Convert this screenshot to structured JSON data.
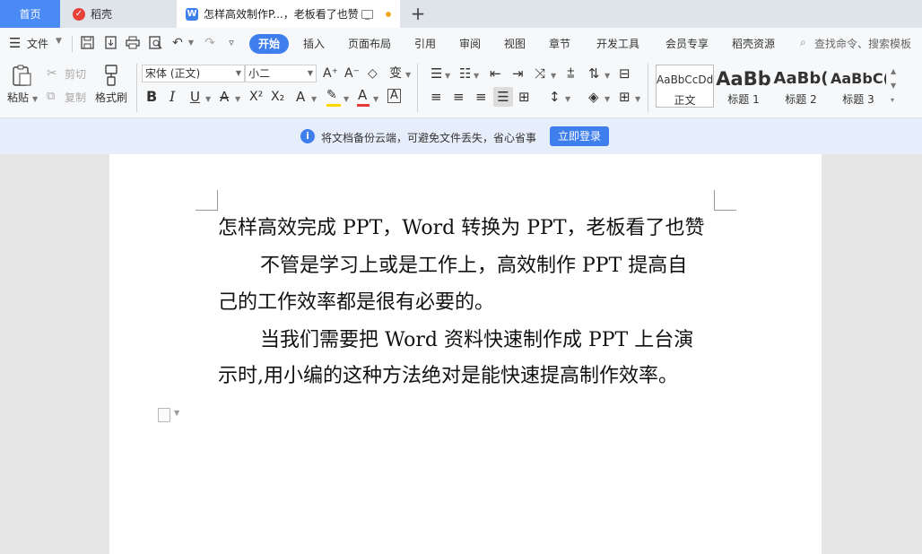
{
  "tabs": {
    "home": "首页",
    "daoke": "稻壳",
    "document": "怎样高效制作P...，老板看了也赞",
    "add": "+"
  },
  "menu": {
    "file": "文件",
    "start": "开始",
    "insert": "插入",
    "page_layout": "页面布局",
    "references": "引用",
    "review": "审阅",
    "view": "视图",
    "chapter": "章节",
    "developer": "开发工具",
    "member": "会员专享",
    "daoke_resources": "稻壳资源",
    "search_placeholder": "查找命令、搜索模板"
  },
  "ribbon": {
    "paste": "粘贴",
    "cut": "剪切",
    "copy": "复制",
    "format_painter": "格式刷",
    "font_family": "宋体 (正文)",
    "font_size": "小二",
    "styles": [
      {
        "sample": "AaBbCcDd",
        "label": "正文"
      },
      {
        "sample": "AaBb",
        "label": "标题 1"
      },
      {
        "sample": "AaBb(",
        "label": "标题 2"
      },
      {
        "sample": "AaBbC(",
        "label": "标题 3"
      }
    ]
  },
  "notification": {
    "text": "将文档备份云端，可避免文件丢失，省心省事",
    "button": "立即登录"
  },
  "document": {
    "lines": [
      "怎样高效完成 PPT，Word 转换为 PPT，老板看了也赞",
      "不管是学习上或是工作上，高效制作 PPT 提高自",
      "己的工作效率都是很有必要的。",
      "当我们需要把 Word 资料快速制作成 PPT 上台演",
      "示时,用小编的这种方法绝对是能快速提高制作效率。"
    ]
  },
  "colors": {
    "accent": "#3f7fed",
    "highlight": "#ffd700",
    "font_color": "#e53935"
  }
}
